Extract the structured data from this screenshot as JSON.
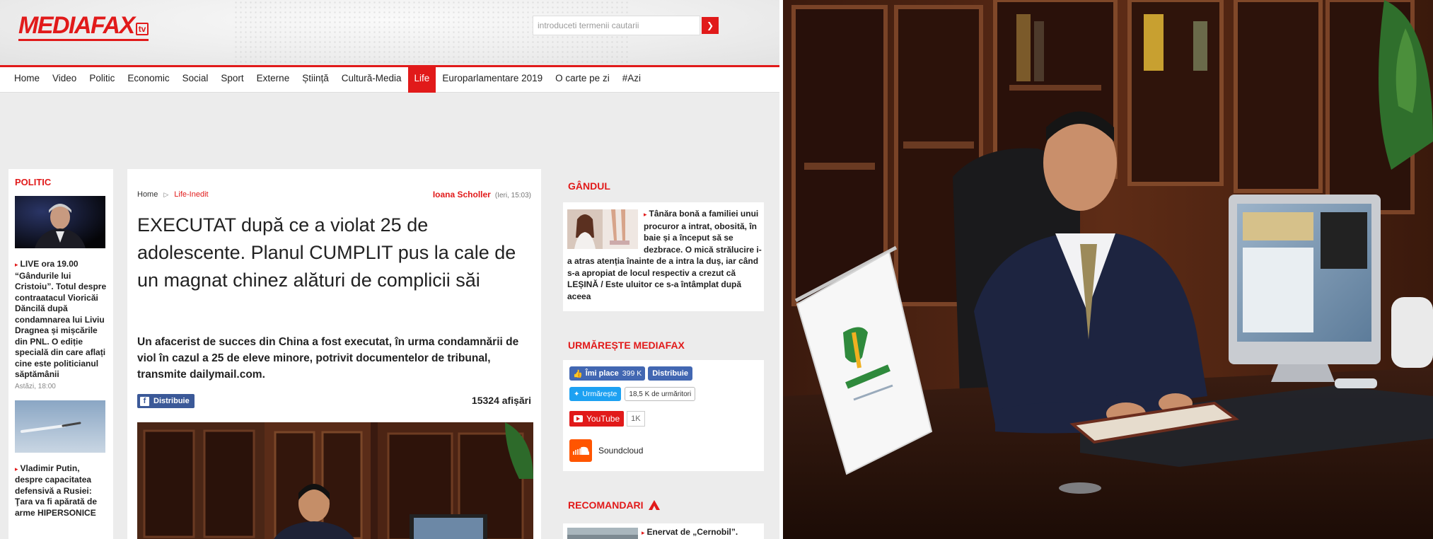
{
  "site": {
    "logo": "MEDIAFAX",
    "logo_badge": "tv",
    "search": {
      "placeholder": "introduceti termenii cautarii"
    },
    "nav": [
      "Home",
      "Video",
      "Politic",
      "Economic",
      "Social",
      "Sport",
      "Externe",
      "Știință",
      "Cultură-Media",
      "Life",
      "Europarlamentare 2019",
      "O carte pe zi",
      "#Azi"
    ],
    "nav_active": "Life",
    "colors": {
      "brand": "#e11a1a",
      "facebook": "#4267b2",
      "twitter": "#1da1f2",
      "soundcloud": "#ff5500"
    }
  },
  "left_column": {
    "section": "POLITIC",
    "items": [
      {
        "text": "LIVE ora 19.00 “Gândurile lui Cristoiu”. Totul despre contraatacul Vioricăi Dăncilă după condamnarea lui Liviu Dragnea și mișcările din PNL. O ediție specială din care aflați cine este politicianul săptămânii",
        "date": "Astăzi, 18:00"
      },
      {
        "text": "Vladimir Putin, despre capacitatea defensivă a Rusiei: Ţara va fi apărată de arme HIPERSONICE",
        "date": ""
      }
    ]
  },
  "article": {
    "breadcrumb": [
      "Home",
      "Life-Inedit"
    ],
    "author": "Ioana Scholler",
    "time": "(Ieri, 15:03)",
    "headline": "EXECUTAT după ce a violat 25 de adolescente. Planul CUMPLIT pus la cale de un magnat chinez alături de complicii săi",
    "lead": "Un afacerist de succes din China a fost executat, în urma condamnării de viol în cazul a 25 de eleve minore, potrivit documentelor de tribunal, transmite dailymail.com.",
    "share_label": "Distribuie",
    "views": "15324 afișări"
  },
  "right_column": {
    "gandul": {
      "title": "GÂNDUL",
      "text": "Tânăra bonă a familiei unui procuror a intrat, obosită, în baie și a început să se dezbrace. O mică strălucire i-a atras atenția înainte de a intra la duș, iar când s-a apropiat de locul respectiv a crezut că LEȘINĂ / Este uluitor ce s-a întâmplat după aceea"
    },
    "follow": {
      "title": "URMĂREȘTE MEDIAFAX",
      "fb_like": "Îmi place",
      "fb_like_count": "399 K",
      "fb_share": "Distribuie",
      "tw_label": "Urmărește",
      "tw_count": "18,5 K de urmăritori",
      "yt_label": "YouTube",
      "yt_count": "1K",
      "sc_label": "Soundcloud"
    },
    "recomandari": {
      "title": "RECOMANDARI",
      "text": "Enervat de „Cernobil”."
    }
  }
}
